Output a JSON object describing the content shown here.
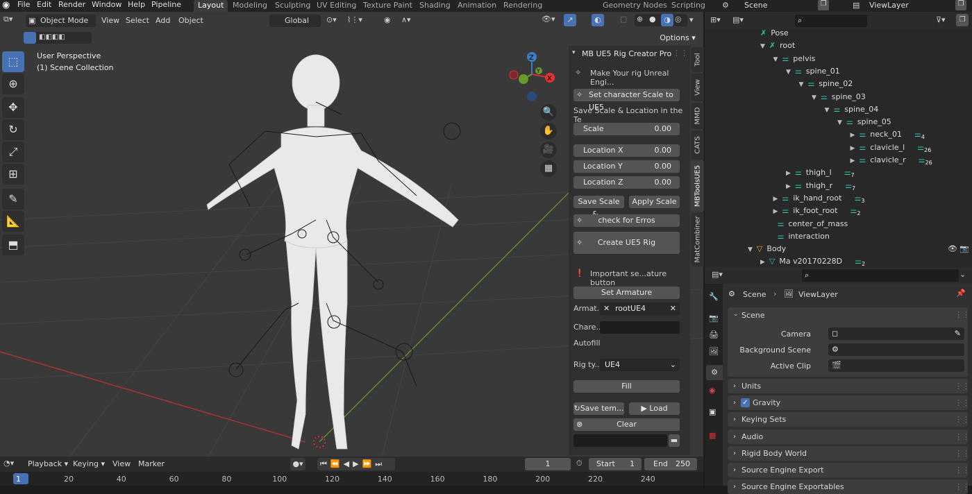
{
  "menubar": {
    "items": [
      "File",
      "Edit",
      "Render",
      "Window",
      "Help",
      "Pipeline"
    ],
    "workspaces": [
      "Layout",
      "Modeling",
      "Sculpting",
      "UV Editing",
      "Texture Paint",
      "Shading",
      "Animation",
      "Rendering",
      "Geometry Nodes",
      "Scripting"
    ],
    "scene_label": "Scene",
    "viewlayer_label": "ViewLayer"
  },
  "viewport": {
    "mode": "Object Mode",
    "menus": [
      "View",
      "Select",
      "Add",
      "Object"
    ],
    "transform": "Global",
    "options": "Options",
    "perspective": "User Perspective",
    "collection": "(1) Scene Collection"
  },
  "npanel": {
    "title": "MB UE5 Rig Creator Pro",
    "tagline": "Make Your rig Unreal Engi...",
    "set_scale": "Set character Scale to UE5",
    "save_hint": "Save Scale & Location in the Te",
    "fields": [
      {
        "label": "Scale",
        "value": "0.00"
      },
      {
        "label": "Location X",
        "value": "0.00"
      },
      {
        "label": "Location Y",
        "value": "0.00"
      },
      {
        "label": "Location Z",
        "value": "0.00"
      }
    ],
    "save_scale": "Save Scale &...",
    "apply_scale": "Apply Scale ...",
    "check": "check for Erros",
    "create": "Create UE5 Rig",
    "important": "Important se...ature button",
    "set_armature": "Set Armature",
    "armature_label": "Armat...",
    "armature_value": "rootUE4",
    "character_label": "Chare...",
    "autofill": "Autofill",
    "rigtype_label": "Rig ty...",
    "rigtype_value": "UE4",
    "fill": "Fill",
    "save_template": "Save tem...",
    "load": "Load",
    "clear": "Clear",
    "tabs": [
      "Tool",
      "View",
      "MMD",
      "CATS",
      "MBToolsUE5",
      "MatCombiner"
    ]
  },
  "outliner": {
    "items": [
      {
        "name": "Pose",
        "indent": 0,
        "badge": ""
      },
      {
        "name": "root",
        "indent": 0,
        "badge": ""
      },
      {
        "name": "pelvis",
        "indent": 1,
        "badge": ""
      },
      {
        "name": "spine_01",
        "indent": 2,
        "badge": ""
      },
      {
        "name": "spine_02",
        "indent": 3,
        "badge": ""
      },
      {
        "name": "spine_03",
        "indent": 4,
        "badge": ""
      },
      {
        "name": "spine_04",
        "indent": 5,
        "badge": ""
      },
      {
        "name": "spine_05",
        "indent": 6,
        "badge": ""
      },
      {
        "name": "neck_01",
        "indent": 7,
        "badge": "4"
      },
      {
        "name": "clavicle_l",
        "indent": 7,
        "badge": "26"
      },
      {
        "name": "clavicle_r",
        "indent": 7,
        "badge": "26"
      },
      {
        "name": "thigh_l",
        "indent": 2,
        "badge": "7"
      },
      {
        "name": "thigh_r",
        "indent": 2,
        "badge": "7"
      },
      {
        "name": "ik_hand_root",
        "indent": 1,
        "badge": "3"
      },
      {
        "name": "ik_foot_root",
        "indent": 1,
        "badge": "2"
      },
      {
        "name": "center_of_mass",
        "indent": 1,
        "badge": ""
      },
      {
        "name": "interaction",
        "indent": 1,
        "badge": ""
      },
      {
        "name": "Body",
        "indent": -1,
        "badge": ""
      },
      {
        "name": "Ma v20170228D",
        "indent": 0,
        "badge": "2"
      }
    ]
  },
  "properties": {
    "breadcrumb_scene": "Scene",
    "breadcrumb_viewlayer": "ViewLayer",
    "section": "Scene",
    "camera": "Camera",
    "background_scene": "Background Scene",
    "active_clip": "Active Clip",
    "panels": [
      "Units",
      "Gravity",
      "Keying Sets",
      "Audio",
      "Rigid Body World",
      "Source Engine Export",
      "Source Engine Exportables"
    ]
  },
  "timeline": {
    "menus": [
      "Playback",
      "Keying",
      "View",
      "Marker"
    ],
    "current_frame": "1",
    "start_label": "Start",
    "start": "1",
    "end_label": "End",
    "end": "250",
    "ticks": [
      "1",
      "20",
      "40",
      "60",
      "80",
      "100",
      "120",
      "140",
      "160",
      "180",
      "200",
      "220",
      "240"
    ]
  }
}
